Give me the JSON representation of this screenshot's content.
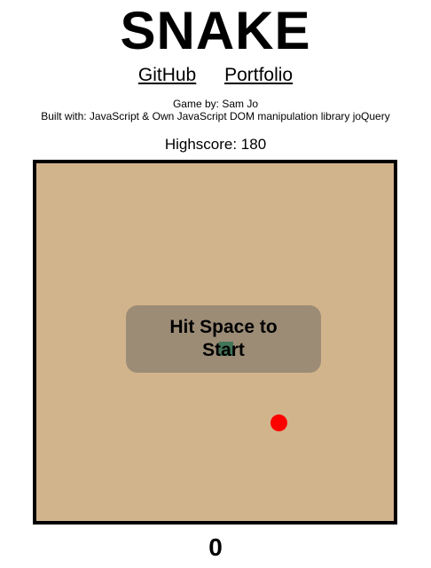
{
  "header": {
    "title": "SNAKE",
    "links": {
      "github": "GitHub",
      "portfolio": "Portfolio"
    },
    "credit_line_1": "Game by: Sam Jo",
    "credit_line_2": "Built with: JavaScript & Own JavaScript DOM manipulation library joQuery",
    "highscore": "Highscore: 180"
  },
  "game": {
    "overlay_message": "Hit Space to Start",
    "score": "0",
    "board_color": "#d2b48c",
    "snake_color": "#2e8b57",
    "food_color": "#ff0000"
  }
}
